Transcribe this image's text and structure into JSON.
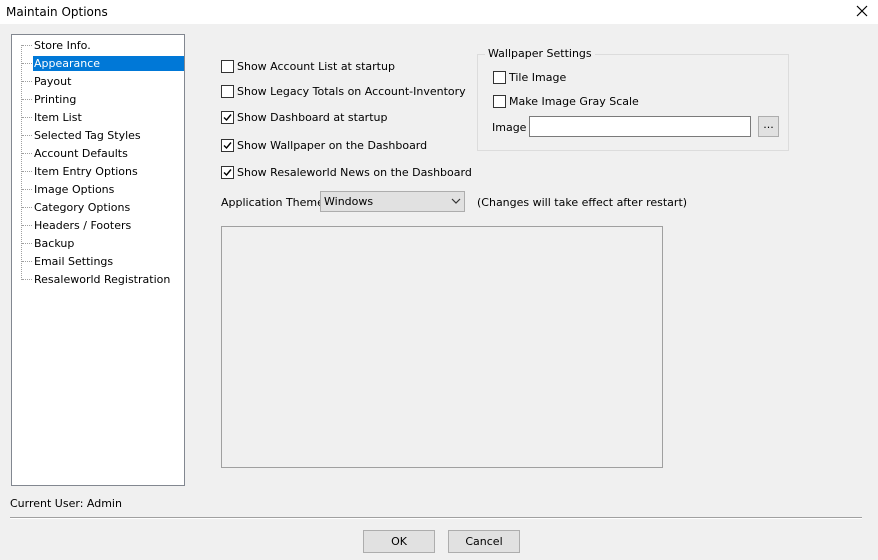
{
  "window": {
    "title": "Maintain Options"
  },
  "tree": {
    "items": [
      {
        "label": "Store Info.",
        "selected": false
      },
      {
        "label": "Appearance",
        "selected": true
      },
      {
        "label": "Payout",
        "selected": false
      },
      {
        "label": "Printing",
        "selected": false
      },
      {
        "label": "Item List",
        "selected": false
      },
      {
        "label": "Selected Tag Styles",
        "selected": false
      },
      {
        "label": "Account Defaults",
        "selected": false
      },
      {
        "label": "Item Entry Options",
        "selected": false
      },
      {
        "label": "Image Options",
        "selected": false
      },
      {
        "label": "Category Options",
        "selected": false
      },
      {
        "label": "Headers / Footers",
        "selected": false
      },
      {
        "label": "Backup",
        "selected": false
      },
      {
        "label": "Email Settings",
        "selected": false
      },
      {
        "label": "Resaleworld Registration",
        "selected": false
      }
    ]
  },
  "appearance": {
    "options": [
      {
        "label": "Show Account List at startup",
        "checked": false
      },
      {
        "label": "Show Legacy Totals on Account-Inventory",
        "checked": false
      },
      {
        "label": "Show Dashboard at startup",
        "checked": true
      },
      {
        "label": "Show Wallpaper on the Dashboard",
        "checked": true
      },
      {
        "label": "Show Resaleworld News on the Dashboard",
        "checked": true
      }
    ],
    "wallpaper": {
      "title": "Wallpaper Settings",
      "tile_label": "Tile Image",
      "tile_checked": false,
      "gray_label": "Make Image Gray Scale",
      "gray_checked": false,
      "image_label": "Image",
      "image_value": "",
      "browse_label": "..."
    },
    "theme": {
      "label": "Application Theme",
      "value": "Windows",
      "note": "(Changes will take effect after restart)"
    }
  },
  "status": {
    "current_user": "Current User: Admin"
  },
  "buttons": {
    "ok": "OK",
    "cancel": "Cancel"
  },
  "colors": {
    "selection": "#0078d7",
    "background": "#f0f0f0"
  }
}
